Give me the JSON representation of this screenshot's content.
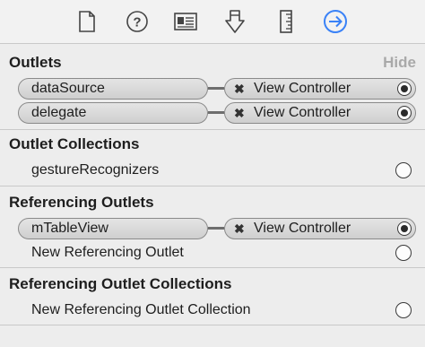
{
  "toolbar": {
    "icons": [
      "file-inspector-icon",
      "quick-help-icon",
      "identity-inspector-icon",
      "attributes-inspector-icon",
      "size-inspector-icon",
      "connections-inspector-icon"
    ],
    "active_color": "#3a82f7"
  },
  "outlets": {
    "title": "Outlets",
    "hide_label": "Hide",
    "items": [
      {
        "name": "dataSource",
        "target": "View Controller",
        "x_mark": "✖"
      },
      {
        "name": "delegate",
        "target": "View Controller",
        "x_mark": "✖"
      }
    ]
  },
  "outlet_collections": {
    "title": "Outlet Collections",
    "items": [
      {
        "name": "gestureRecognizers"
      }
    ]
  },
  "referencing_outlets": {
    "title": "Referencing Outlets",
    "connected": {
      "name": "mTableView",
      "target": "View Controller",
      "x_mark": "✖"
    },
    "new_label": "New Referencing Outlet"
  },
  "referencing_outlet_collections": {
    "title": "Referencing Outlet Collections",
    "new_label": "New Referencing Outlet Collection"
  }
}
